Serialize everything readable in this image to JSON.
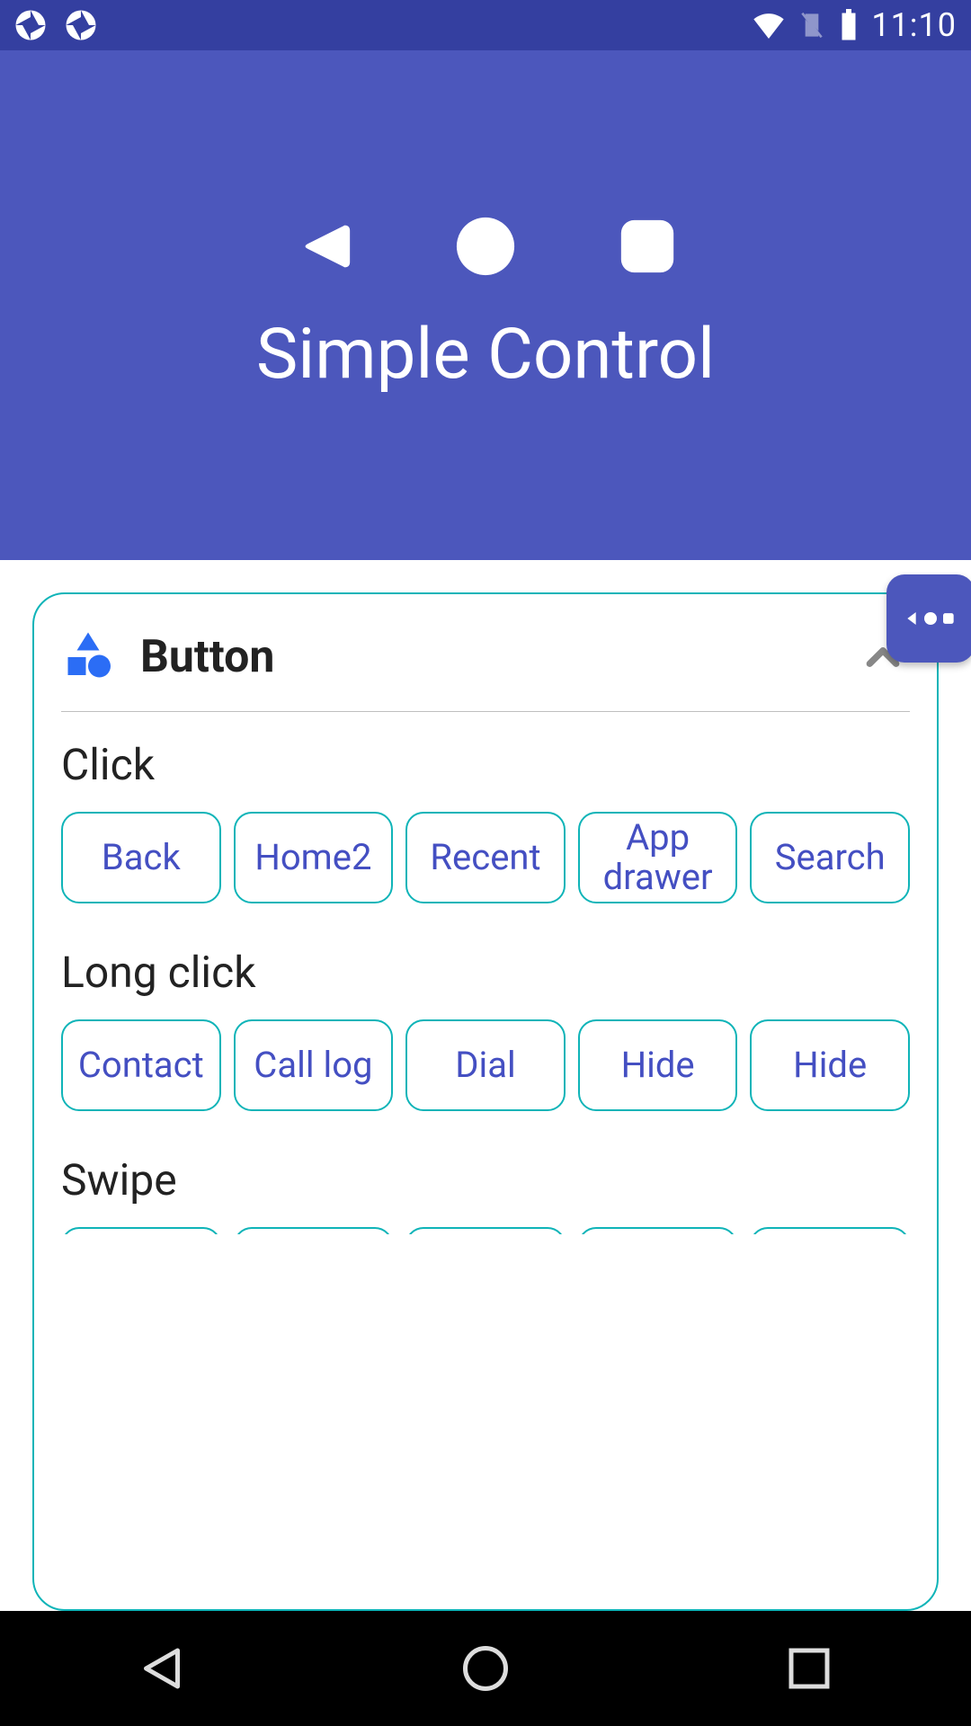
{
  "status": {
    "time": "11:10"
  },
  "header": {
    "title": "Simple Control"
  },
  "card": {
    "title": "Button",
    "sections": {
      "click": {
        "label": "Click",
        "chips": [
          "Back",
          "Home2",
          "Recent",
          "App drawer",
          "Search"
        ]
      },
      "longclick": {
        "label": "Long click",
        "chips": [
          "Contact",
          "Call log",
          "Dial",
          "Hide",
          "Hide"
        ]
      },
      "swipe": {
        "label": "Swipe"
      }
    }
  },
  "icons": {
    "aperture": "aperture-icon",
    "wifi": "wifi-icon",
    "sim": "sim-icon",
    "battery": "battery-icon",
    "back_triangle": "back-triangle-icon",
    "home_circle": "home-circle-icon",
    "recent_square": "recent-square-icon",
    "shapes": "shapes-icon",
    "chevron_up": "chevron-up-icon",
    "nav_back": "nav-back-icon",
    "nav_home": "nav-home-icon",
    "nav_recent": "nav-recent-icon"
  }
}
